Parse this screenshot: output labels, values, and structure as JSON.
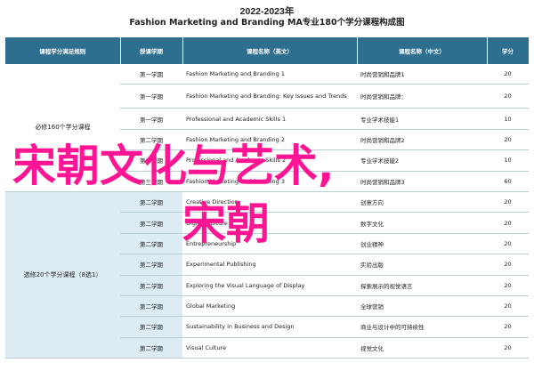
{
  "title_top": "2022-2023年",
  "title_main": "Fashion Marketing and Branding MA专业180个学分课程构成图",
  "headers": [
    "课程学分满足规则",
    "授课学期",
    "课程名称（英文）",
    "课程名称（中文）",
    "学分"
  ],
  "group1": {
    "rule": "必修160个学分课程",
    "rows": [
      {
        "sem": "第一学期",
        "en": "Fashion Marketing and Branding 1",
        "zh": "时尚营销和品牌1",
        "credits": "20"
      },
      {
        "sem": "第一学期",
        "en": "Fashion Marketing and Branding: Key Issues and Trends",
        "zh": "时尚营销和品牌：",
        "credits": "20"
      },
      {
        "sem": "第一学期",
        "en": "Professional and Academic Skills 1",
        "zh": "专业学术技能1",
        "credits": "10"
      },
      {
        "sem": "第二学期",
        "en": "Fashion Marketing and Branding 2",
        "zh": "时尚营销和品牌2",
        "credits": "20"
      },
      {
        "sem": "第二学期",
        "en": "Professional and Academic Skills 2",
        "zh": "专业学术技能2",
        "credits": "10"
      },
      {
        "sem": "第三学期",
        "en": "Fashion Marketing and Branding 3",
        "zh": "时尚营销和品牌3",
        "credits": "60"
      }
    ]
  },
  "group2": {
    "rule": "选修20个学分课程（8选1）",
    "rows": [
      {
        "sem": "第二学期",
        "en": "Creative Direction",
        "zh": "创意方向",
        "credits": "20"
      },
      {
        "sem": "第二学期",
        "en": "Digital Culture",
        "zh": "数字文化",
        "credits": "20"
      },
      {
        "sem": "第二学期",
        "en": "Entrepreneurship",
        "zh": "创业精神",
        "credits": "20"
      },
      {
        "sem": "第二学期",
        "en": "Experimental Publishing",
        "zh": "实验出版",
        "credits": "20"
      },
      {
        "sem": "第二学期",
        "en": "Exploring the Visual Language of Display",
        "zh": "探索展示的视觉语言",
        "credits": "20"
      },
      {
        "sem": "第二学期",
        "en": "Global Marketing",
        "zh": "全球营销",
        "credits": "20"
      },
      {
        "sem": "第二学期",
        "en": "Sustainability in Business and Design",
        "zh": "商业与设计中的可持续性",
        "credits": "20"
      },
      {
        "sem": "第二学期",
        "en": "Visual Culture",
        "zh": "视觉文化",
        "credits": "20"
      }
    ]
  },
  "overlay_line1": "宋朝文化与艺术,",
  "overlay_line2": "宋朝"
}
